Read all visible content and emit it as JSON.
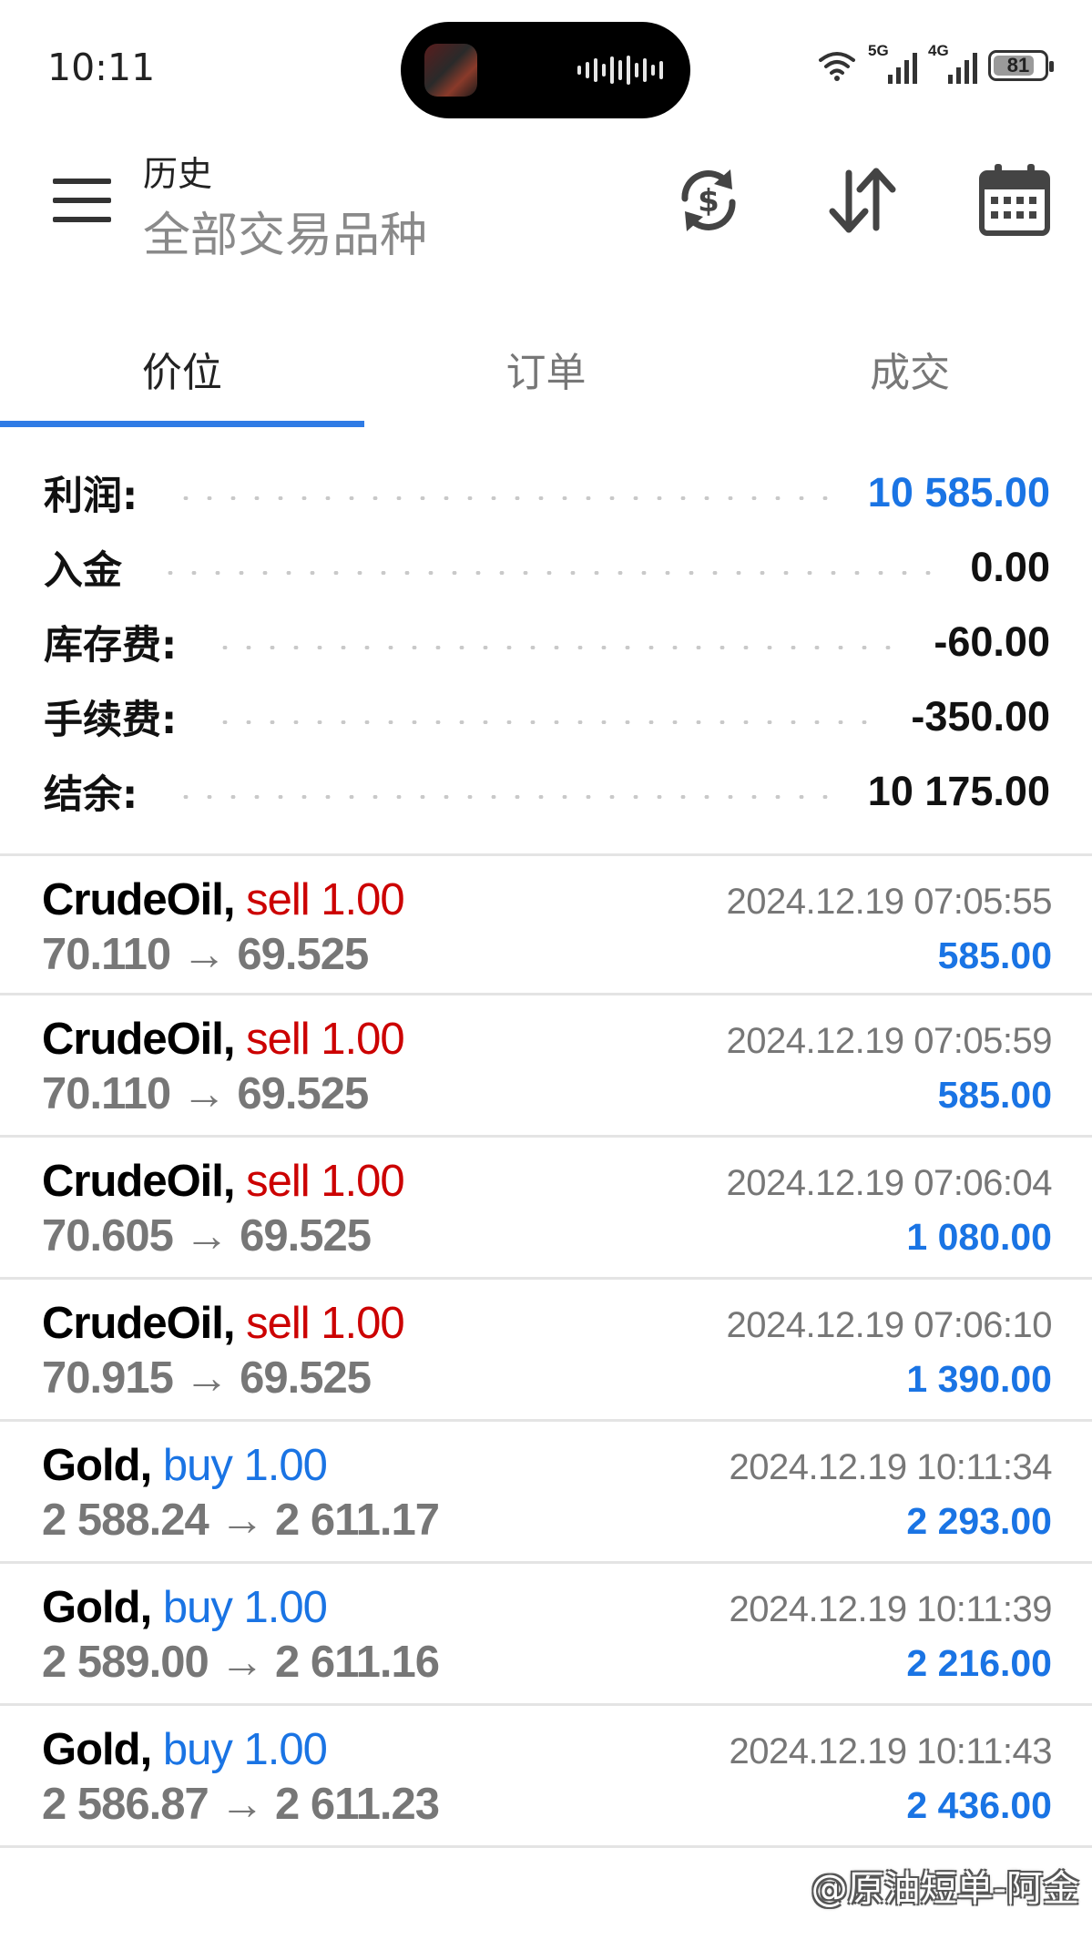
{
  "status_bar": {
    "time": "10:11",
    "signal_1": "5G",
    "signal_2": "4G",
    "battery": "81"
  },
  "header": {
    "title": "历史",
    "subtitle": "全部交易品种",
    "icons": [
      "menu-icon",
      "currency-exchange-icon",
      "sort-icon",
      "calendar-icon"
    ]
  },
  "tabs": [
    {
      "label": "价位",
      "active": true
    },
    {
      "label": "订单",
      "active": false
    },
    {
      "label": "成交",
      "active": false
    }
  ],
  "summary": {
    "profit": {
      "label": "利润:",
      "value": "10 585.00"
    },
    "deposit": {
      "label": "入金",
      "value": "0.00"
    },
    "swap": {
      "label": "库存费:",
      "value": "-60.00"
    },
    "commission": {
      "label": "手续费:",
      "value": "-350.00"
    },
    "balance": {
      "label": "结余:",
      "value": "10 175.00"
    }
  },
  "trades": [
    {
      "symbol": "CrudeOil,",
      "side": "sell 1.00",
      "prices": "70.110 → 69.525",
      "time": "2024.12.19 07:05:55",
      "profit": "585.00"
    },
    {
      "symbol": "CrudeOil,",
      "side": "sell 1.00",
      "prices": "70.110 → 69.525",
      "time": "2024.12.19 07:05:59",
      "profit": "585.00"
    },
    {
      "symbol": "CrudeOil,",
      "side": "sell 1.00",
      "prices": "70.605 → 69.525",
      "time": "2024.12.19 07:06:04",
      "profit": "1 080.00"
    },
    {
      "symbol": "CrudeOil,",
      "side": "sell 1.00",
      "prices": "70.915 → 69.525",
      "time": "2024.12.19 07:06:10",
      "profit": "1 390.00"
    },
    {
      "symbol": "Gold,",
      "side": "buy 1.00",
      "prices": "2 588.24 → 2 611.17",
      "time": "2024.12.19 10:11:34",
      "profit": "2 293.00"
    },
    {
      "symbol": "Gold,",
      "side": "buy 1.00",
      "prices": "2 589.00 → 2 611.16",
      "time": "2024.12.19 10:11:39",
      "profit": "2 216.00"
    },
    {
      "symbol": "Gold,",
      "side": "buy 1.00",
      "prices": "2 586.87 → 2 611.23",
      "time": "2024.12.19 10:11:43",
      "profit": "2 436.00"
    }
  ],
  "watermark": "@原油短单-阿金",
  "colors": {
    "accent": "#2f7be5",
    "profit_blue": "#1a74e4",
    "sell_red": "#cc0000"
  }
}
